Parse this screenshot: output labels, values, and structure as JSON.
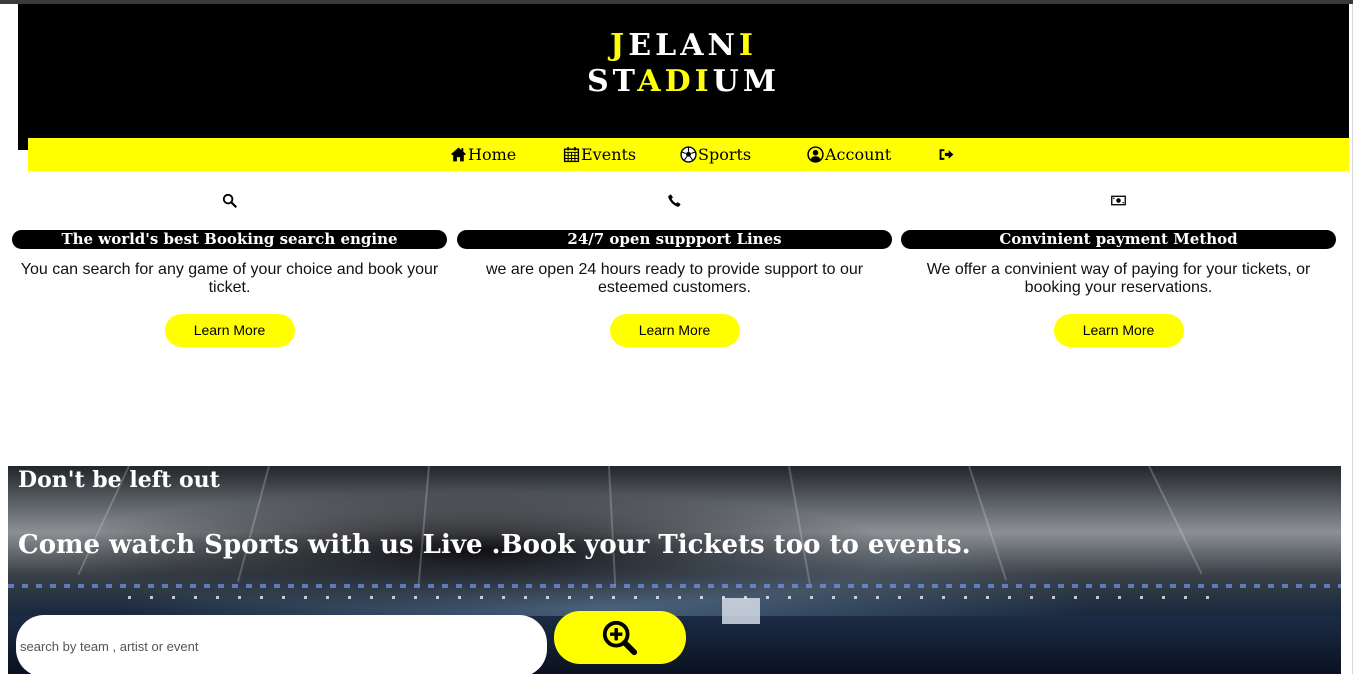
{
  "brand": {
    "line1": [
      {
        "t": "J",
        "hl": true
      },
      {
        "t": "ELAN",
        "hl": false
      },
      {
        "t": "I",
        "hl": true
      }
    ],
    "line2": [
      {
        "t": "ST",
        "hl": false
      },
      {
        "t": "ADI",
        "hl": true
      },
      {
        "t": "UM",
        "hl": false
      }
    ]
  },
  "nav": {
    "items": [
      {
        "label": "Home",
        "icon": "home-icon"
      },
      {
        "label": "Events",
        "icon": "calendar-icon"
      },
      {
        "label": "Sports",
        "icon": "soccer-ball-icon"
      },
      {
        "label": "Account",
        "icon": "user-circle-icon"
      },
      {
        "label": "",
        "icon": "sign-out-icon"
      }
    ]
  },
  "features": [
    {
      "icon": "search-icon",
      "title": "The world's best Booking search engine",
      "text": "You can search for any game of your choice and book your ticket.",
      "button": "Learn More"
    },
    {
      "icon": "phone-icon",
      "title": "24/7 open suppport Lines",
      "text": "we are open 24 hours ready to provide support to our esteemed customers.",
      "button": "Learn More"
    },
    {
      "icon": "money-icon",
      "title": "Convinient payment Method",
      "text": "We offer a convinient way of paying for your tickets, or booking your reservations.",
      "button": "Learn More"
    }
  ],
  "hero": {
    "subtitle": "Don't be left out",
    "title": "Come watch Sports with us Live .Book your Tickets too to events.",
    "search_placeholder": "search by team , artist or event",
    "search_icon": "zoom-in-icon"
  },
  "colors": {
    "accent": "#ffff00",
    "dark": "#000000"
  }
}
